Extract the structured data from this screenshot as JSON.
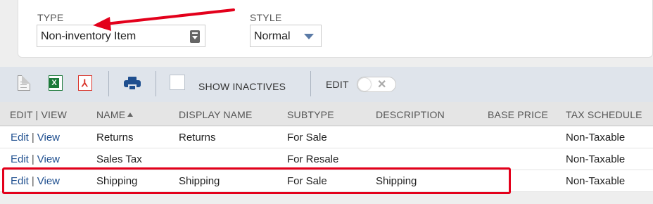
{
  "filters": {
    "type_label": "TYPE",
    "type_value": "Non-inventory Item",
    "style_label": "STYLE",
    "style_value": "Normal"
  },
  "toolbar": {
    "show_inactives_label": "SHOW INACTIVES",
    "edit_label": "EDIT",
    "icons": [
      "document-icon",
      "excel-icon",
      "pdf-icon",
      "printer-icon"
    ]
  },
  "table": {
    "columns": [
      "EDIT | VIEW",
      "NAME",
      "DISPLAY NAME",
      "SUBTYPE",
      "DESCRIPTION",
      "BASE PRICE",
      "TAX SCHEDULE"
    ],
    "rows": [
      {
        "edit": "Edit",
        "sep": "|",
        "view": "View",
        "name": "Returns",
        "display_name": "Returns",
        "subtype": "For Sale",
        "description": "",
        "base_price": "",
        "tax_schedule": "Non-Taxable"
      },
      {
        "edit": "Edit",
        "sep": "|",
        "view": "View",
        "name": "Sales Tax",
        "display_name": "",
        "subtype": "For Resale",
        "description": "",
        "base_price": "",
        "tax_schedule": "Non-Taxable"
      },
      {
        "edit": "Edit",
        "sep": "|",
        "view": "View",
        "name": "Shipping",
        "display_name": "Shipping",
        "subtype": "For Sale",
        "description": "Shipping",
        "base_price": "",
        "tax_schedule": "Non-Taxable"
      }
    ]
  },
  "colors": {
    "link": "#1f4f8f",
    "annotation": "#e3001b",
    "toolbar_bg": "#dfe4eb"
  }
}
